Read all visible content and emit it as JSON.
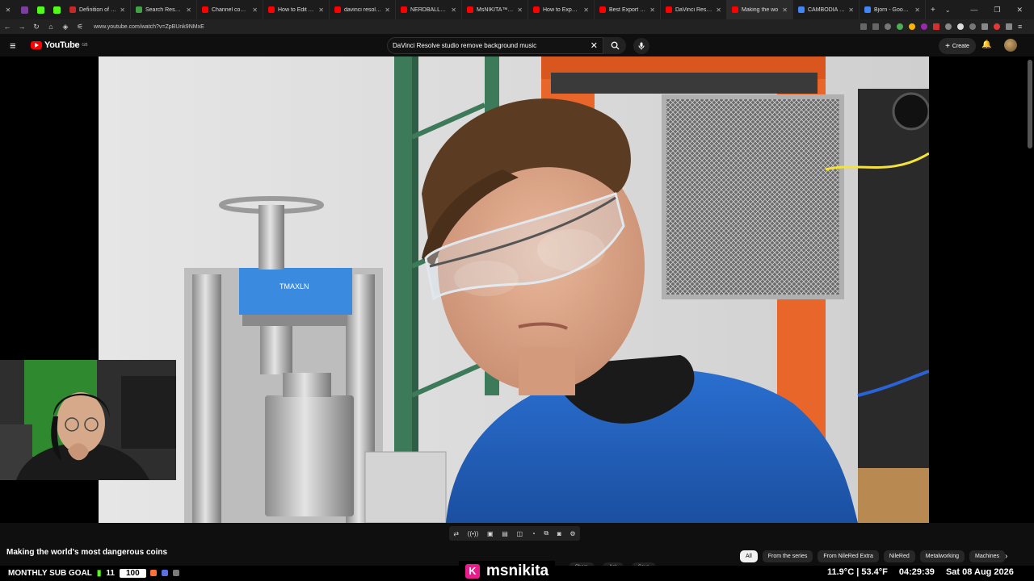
{
  "browser": {
    "tabs": [
      {
        "label": "Definition of 유튜브",
        "color": "#c62828"
      },
      {
        "label": "Search Results | Trai",
        "color": "#43a047"
      },
      {
        "label": "Channel content - Yo",
        "color": "#ff0000"
      },
      {
        "label": "How to Edit A Video",
        "color": "#ff0000"
      },
      {
        "label": "davinci resolve track",
        "color": "#ff0000"
      },
      {
        "label": "NERDBALLERTV - Yo",
        "color": "#ff0000"
      },
      {
        "label": "MsNIKITA™ - YouTu",
        "color": "#ff0000"
      },
      {
        "label": "How to Export Video",
        "color": "#ff0000"
      },
      {
        "label": "Best Export Settings",
        "color": "#ff0000"
      },
      {
        "label": "DaVinci Resolve FRE",
        "color": "#ff0000"
      },
      {
        "label": "Making the wo",
        "color": "#ff0000"
      },
      {
        "label": "CAMBODIA - Googl",
        "color": "#4285f4"
      },
      {
        "label": "Bjorn - Google Sear",
        "color": "#4285f4"
      }
    ],
    "url": "www.youtube.com/watch?v=ZpBUnk9NMxE"
  },
  "youtube": {
    "logo_text": "YouTube",
    "logo_region": "GB",
    "search_value": "DaVinci Resolve studio remove background music",
    "create_label": "Create",
    "video_title": "Making the world's most dangerous coins",
    "video_overlay": {
      "press_label": "TMAXLN"
    },
    "chips": [
      "All",
      "From the series",
      "From NileRed Extra",
      "NileRed",
      "Metalworking",
      "Machines"
    ],
    "actions": [
      "Share",
      "Ask",
      "Save"
    ]
  },
  "stream_overlay": {
    "sub_goal_label": "MONTHLY SUB GOAL",
    "sub_goal_current": "11",
    "sub_goal_target": "100",
    "channel_name": "msnikita",
    "temp_c": "11.9°C",
    "temp_f": "53.4°F",
    "time": "04:29:39",
    "date": "Sat 08 Aug 2026"
  },
  "colors": {
    "youtube_red": "#ff0000",
    "kick_pink": "#e91e8c",
    "kick_green": "#53fc18"
  }
}
